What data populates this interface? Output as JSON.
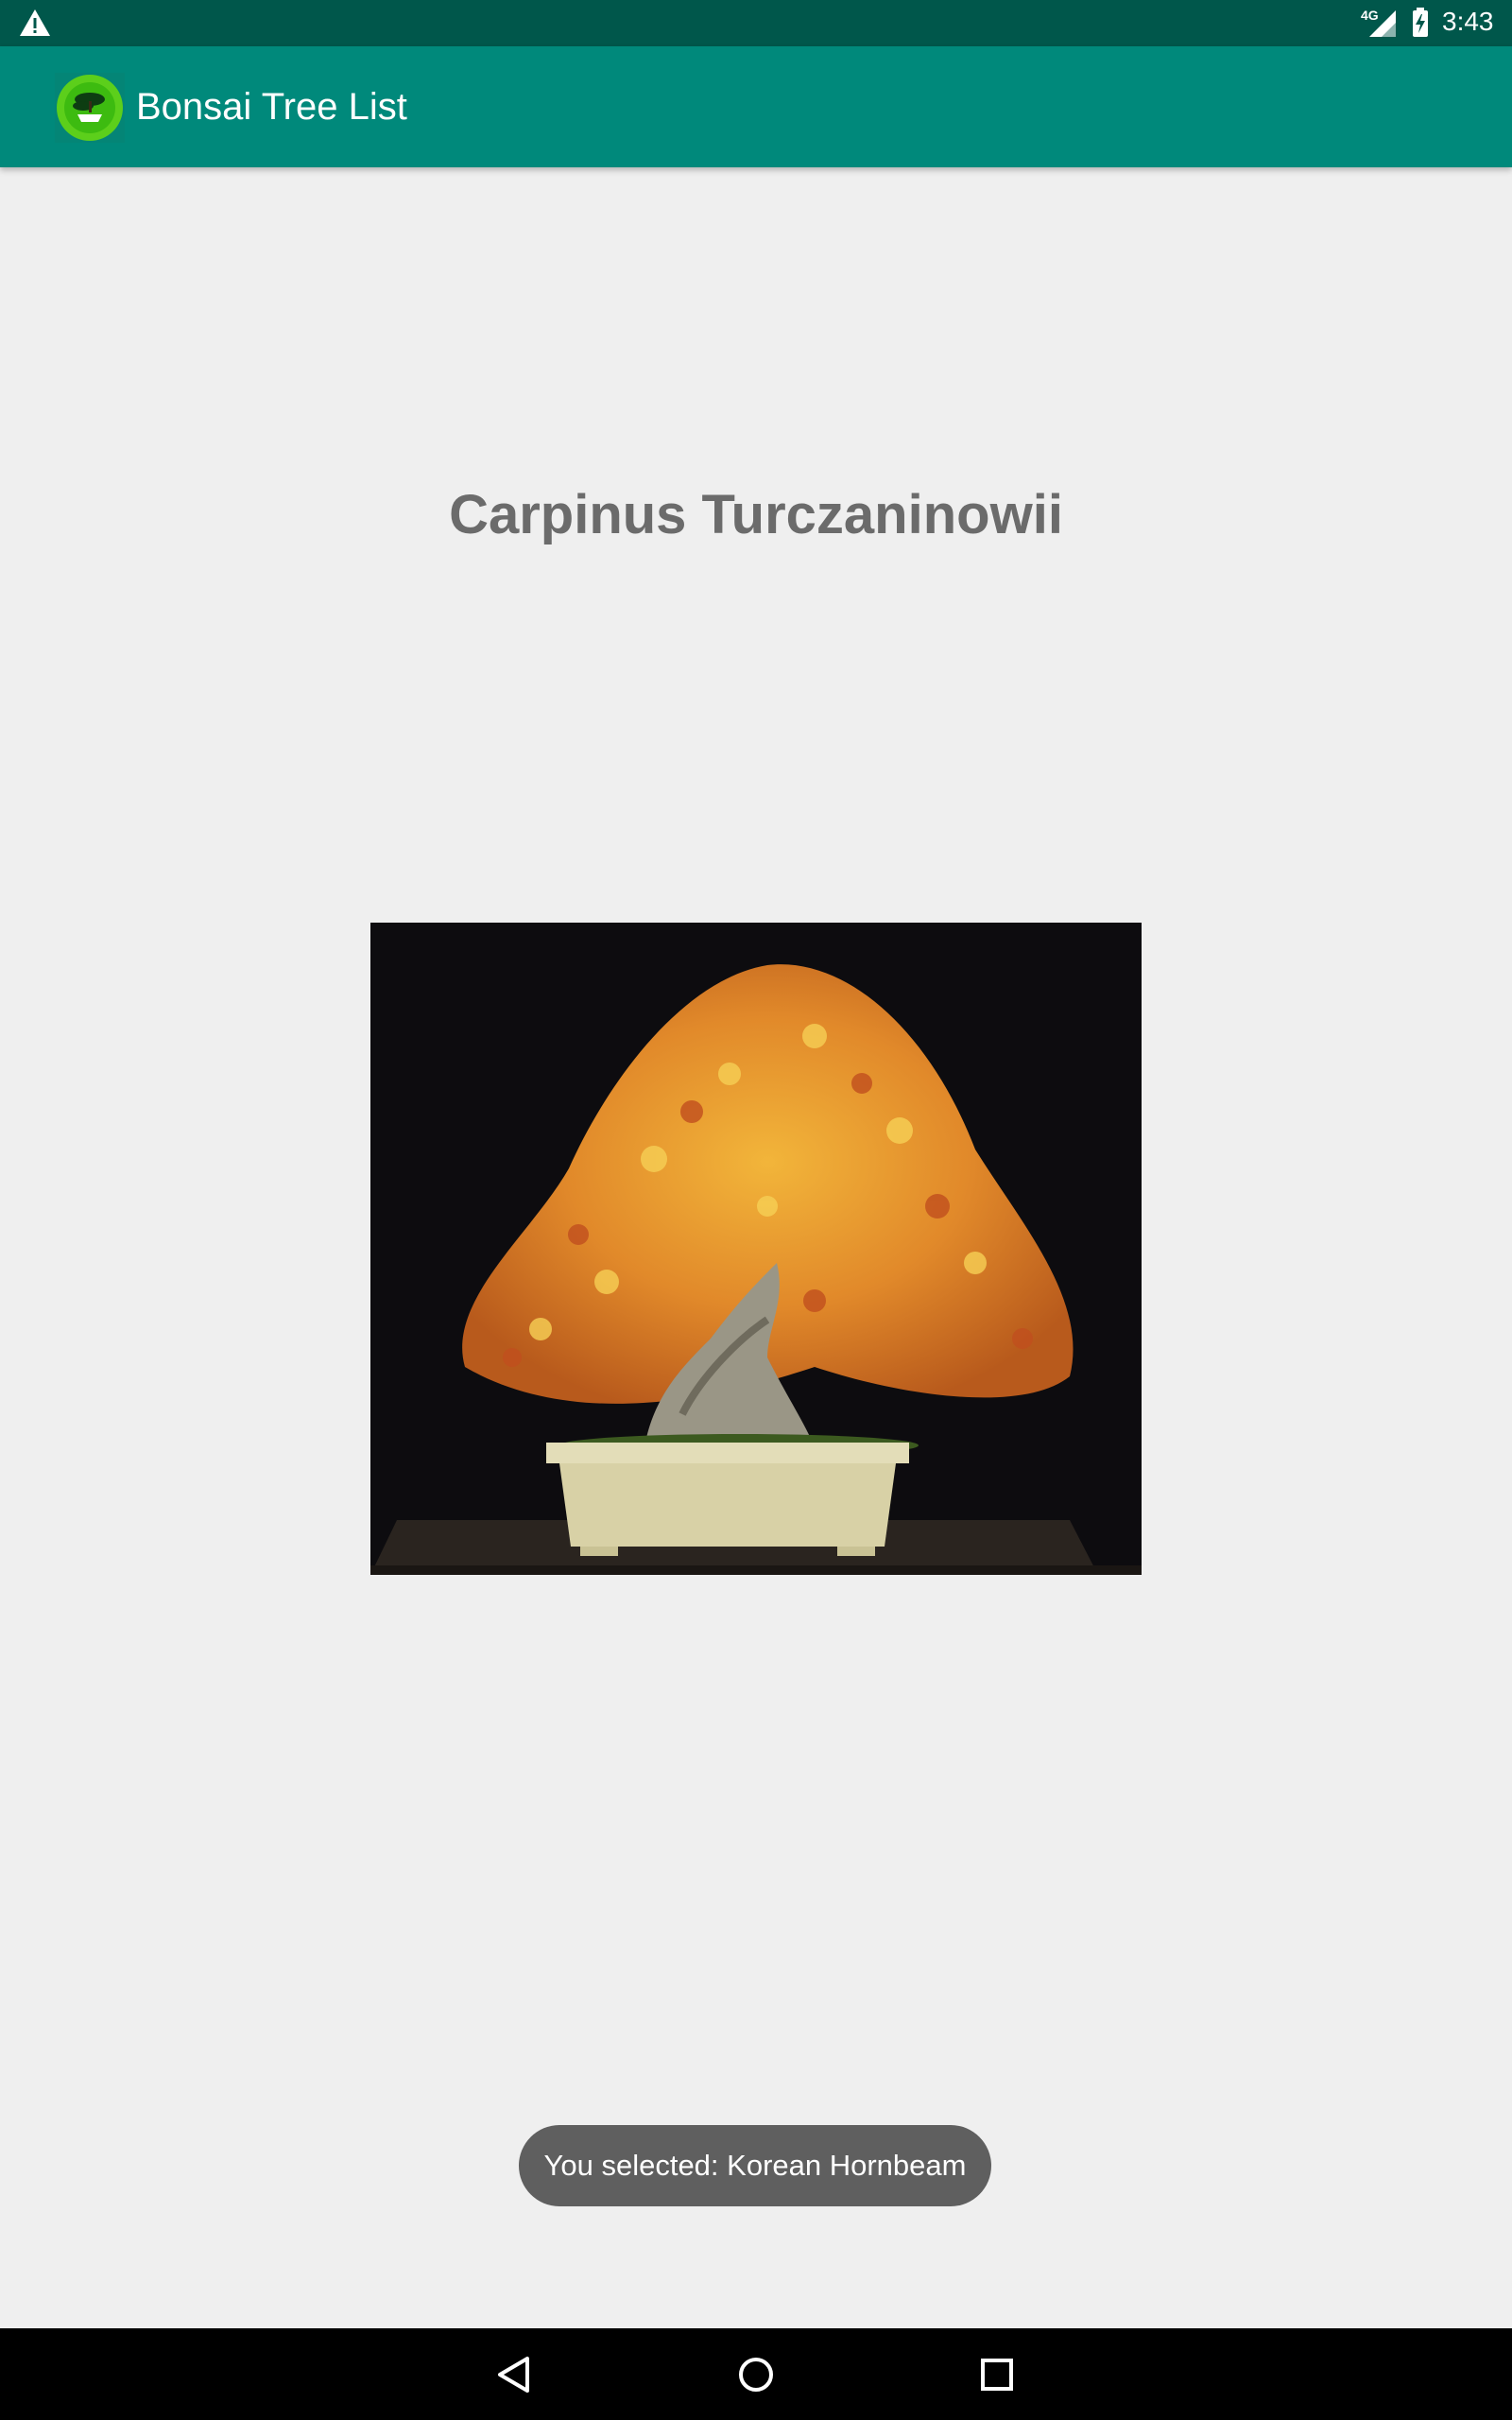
{
  "status_bar": {
    "network_label": "4G",
    "time": "3:43",
    "icons": [
      "warning-icon",
      "signal-icon",
      "battery-charging-icon"
    ]
  },
  "app_bar": {
    "title": "Bonsai Tree List",
    "logo_icon": "bonsai-logo-icon"
  },
  "main": {
    "species_title": "Carpinus Turczaninowii",
    "photo_subject": "bonsai-tree-photo"
  },
  "toast": {
    "message": "You selected: Korean Hornbeam"
  },
  "nav_bar": {
    "icons": [
      "back-icon",
      "home-icon",
      "recents-icon"
    ]
  },
  "colors": {
    "status_bar": "#00574b",
    "app_bar": "#00897b",
    "background": "#efefef",
    "title_text": "#6b6b6b",
    "toast_bg": "#5f5f5f",
    "nav_bar": "#000000"
  }
}
